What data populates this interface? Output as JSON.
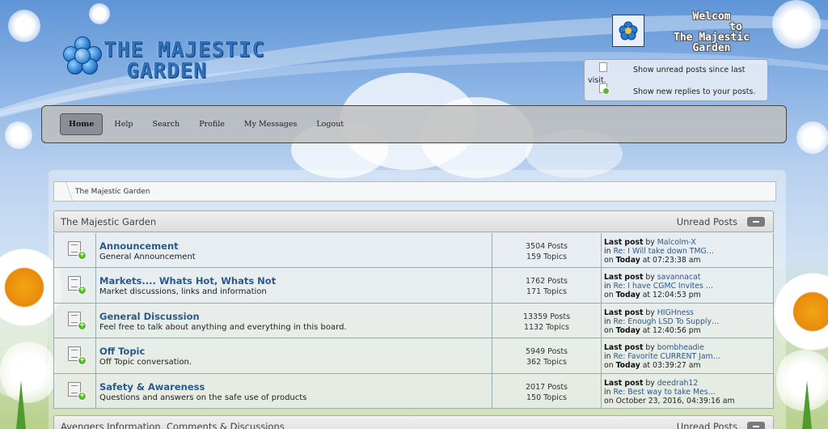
{
  "header": {
    "logo_line1": "THE MAJESTIC",
    "logo_line2": "GARDEN",
    "welcome_line1": "Welcom",
    "welcome_line2": "to",
    "welcome_line3": "The Majestic",
    "welcome_line4": "Garden"
  },
  "notifications": {
    "unread_label": "Show unread posts since last",
    "unread_label_cont": "visit.",
    "replies_label": "Show new replies to your posts."
  },
  "nav": {
    "items": [
      {
        "label": "Home",
        "active": true
      },
      {
        "label": "Help"
      },
      {
        "label": "Search"
      },
      {
        "label": "Profile"
      },
      {
        "label": "My Messages"
      },
      {
        "label": "Logout"
      }
    ]
  },
  "breadcrumb": {
    "label": "The Majestic Garden"
  },
  "categories": [
    {
      "title": "The Majestic Garden",
      "unread_label": "Unread Posts",
      "boards": [
        {
          "name": "Announcement",
          "description": "General Announcement",
          "posts": "3504 Posts",
          "topics": "159 Topics",
          "last_post_label": "Last post",
          "by": "by",
          "author": "Malcolm-X",
          "in": "in",
          "topic": "Re: I Will take down TMG…",
          "on": "on",
          "date_bold": "Today",
          "time": "at 07:23:38 am"
        },
        {
          "name": "Markets.... Whats Hot, Whats Not",
          "description": "Market discussions, links and information",
          "posts": "1762 Posts",
          "topics": "171 Topics",
          "last_post_label": "Last post",
          "by": "by",
          "author": "savannacat",
          "in": "in",
          "topic": "Re: I have CGMC Invites …",
          "on": "on",
          "date_bold": "Today",
          "time": "at 12:04:53 pm"
        },
        {
          "name": "General Discussion",
          "description": "Feel free to talk about anything and everything in this board.",
          "posts": "13359 Posts",
          "topics": "1132 Topics",
          "last_post_label": "Last post",
          "by": "by",
          "author": "HIGHness",
          "in": "in",
          "topic": "Re: Enough LSD To Supply…",
          "on": "on",
          "date_bold": "Today",
          "time": "at 12:40:56 pm"
        },
        {
          "name": "Off Topic",
          "description": "Off Topic conversation.",
          "posts": "5949 Posts",
          "topics": "362 Topics",
          "last_post_label": "Last post",
          "by": "by",
          "author": "bombheadie",
          "in": "in",
          "topic": "Re: Favorite CURRENT Jam…",
          "on": "on",
          "date_bold": "Today",
          "time": "at 03:39:27 am"
        },
        {
          "name": "Safety & Awareness",
          "description": "Questions and answers on the safe use of products",
          "posts": "2017 Posts",
          "topics": "150 Topics",
          "last_post_label": "Last post",
          "by": "by",
          "author": "deedrah12",
          "in": "in",
          "topic": "Re: Best way to take Mes…",
          "on": "on",
          "date_bold": "",
          "time": "October 23, 2016, 04:39:16 am"
        }
      ]
    },
    {
      "title": "Avengers Information, Comments & Discussions",
      "unread_label": "Unread Posts"
    }
  ],
  "icons": {
    "logo": "flower-logo-icon",
    "avatar": "flower-avatar-icon",
    "unread": "document-icon",
    "replies": "document-new-icon",
    "board": "board-new-posts-icon",
    "collapse": "collapse-minus-icon"
  }
}
